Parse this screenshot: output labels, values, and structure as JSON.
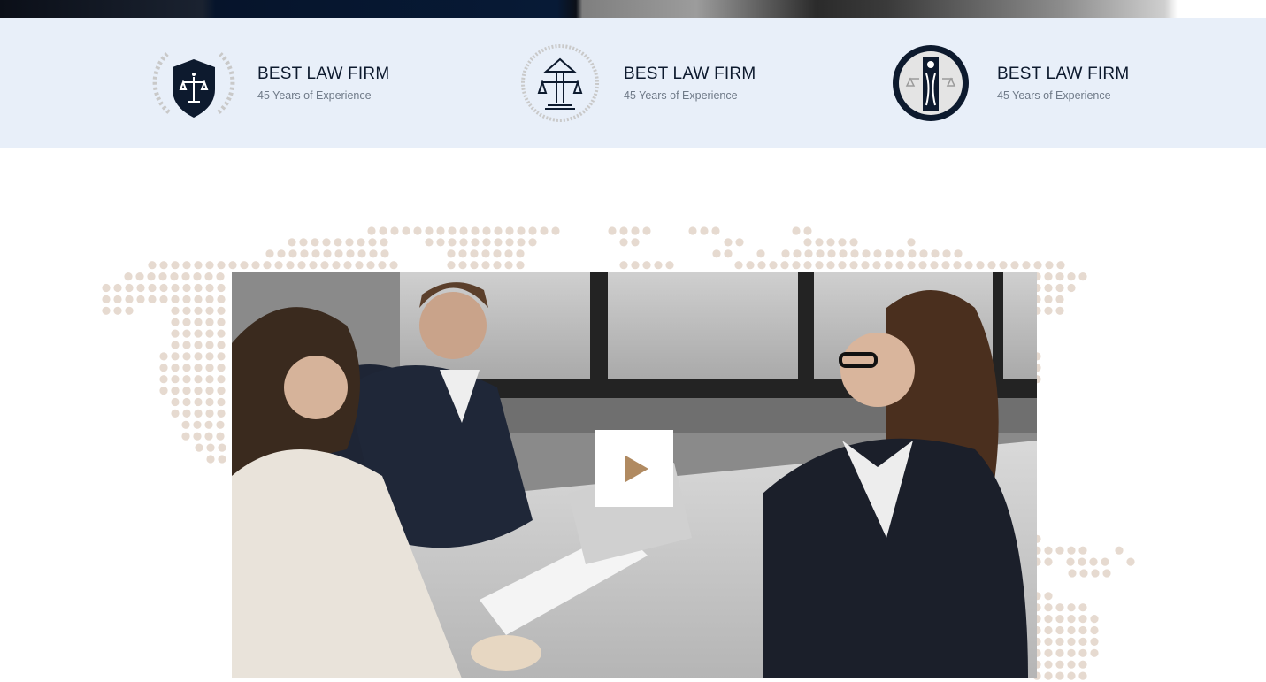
{
  "awards": [
    {
      "title": "BEST LAW FIRM",
      "subtitle": "45 Years of Experience",
      "badge_icon": "shield-scales-icon"
    },
    {
      "title": "BEST LAW FIRM",
      "subtitle": "45 Years of Experience",
      "badge_icon": "pillar-scales-icon"
    },
    {
      "title": "BEST LAW FIRM",
      "subtitle": "45 Years of Experience",
      "badge_icon": "laurel-justice-icon"
    }
  ],
  "colors": {
    "band_background": "#e8eff9",
    "navy": "#0d1a2e",
    "accent": "#b08a61",
    "map_dot": "#e6dad0"
  },
  "video": {
    "play_icon": "play-icon"
  }
}
